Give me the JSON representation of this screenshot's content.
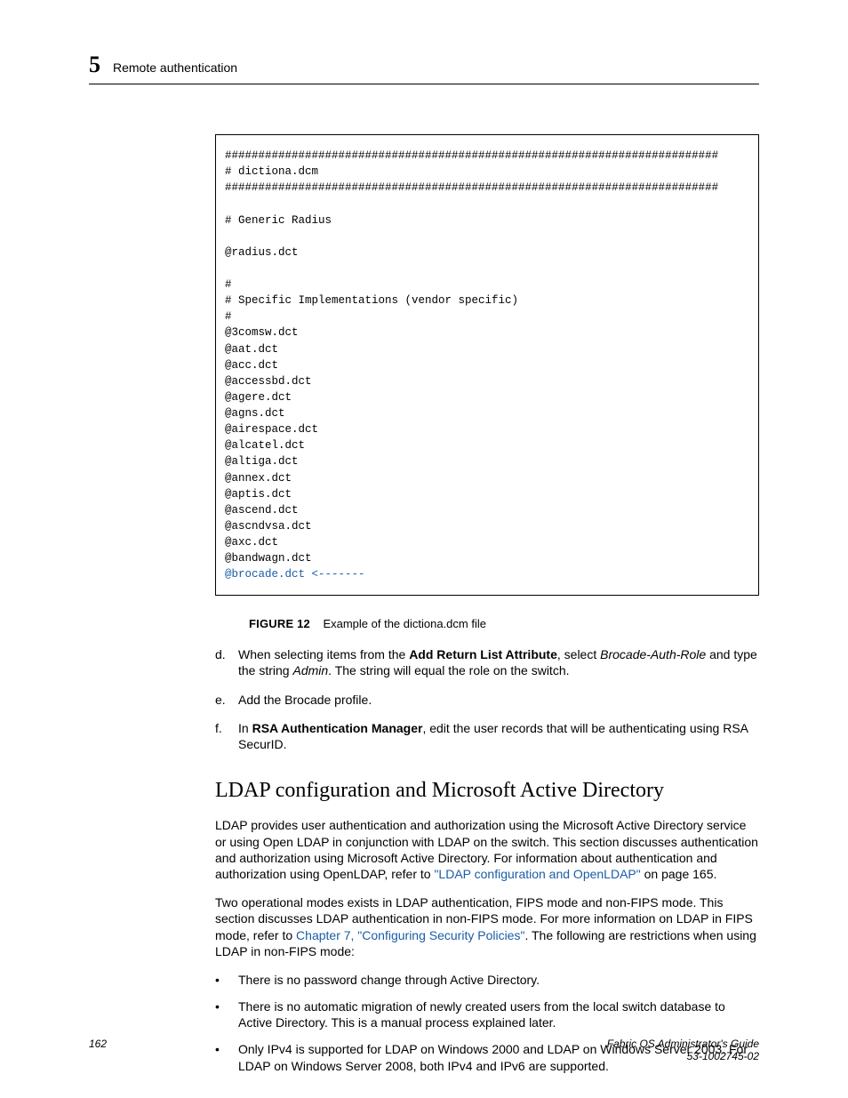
{
  "header": {
    "chapter_number": "5",
    "chapter_title": "Remote authentication"
  },
  "code_block": {
    "lines": [
      "##########################################################################",
      "# dictiona.dcm",
      "##########################################################################",
      "",
      "# Generic Radius",
      "",
      "@radius.dct",
      "",
      "#",
      "# Specific Implementations (vendor specific)",
      "#",
      "@3comsw.dct",
      "@aat.dct",
      "@acc.dct",
      "@accessbd.dct",
      "@agere.dct",
      "@agns.dct",
      "@airespace.dct",
      "@alcatel.dct",
      "@altiga.dct",
      "@annex.dct",
      "@aptis.dct",
      "@ascend.dct",
      "@ascndvsa.dct",
      "@axc.dct",
      "@bandwagn.dct"
    ],
    "highlight_line": "@brocade.dct <-------"
  },
  "figure": {
    "label": "FIGURE 12",
    "caption": "Example of the dictiona.dcm file"
  },
  "steps": {
    "d": {
      "marker": "d.",
      "pre": "When selecting items from the ",
      "bold1": "Add Return List Attribute",
      "mid1": ", select ",
      "ital1": "Brocade-Auth-Role",
      "mid2": " and type the string ",
      "ital2": "Admin",
      "post": ". The string will equal the role on the switch."
    },
    "e": {
      "marker": "e.",
      "text": "Add the Brocade profile."
    },
    "f": {
      "marker": "f.",
      "pre": "In ",
      "bold1": "RSA Authentication Manager",
      "post": ", edit the user records that will be authenticating using RSA SecurID."
    }
  },
  "section": {
    "heading": "LDAP configuration and Microsoft Active Directory",
    "para1": {
      "t1": "LDAP provides user authentication and authorization using the Microsoft Active Directory service or using Open LDAP in conjunction with LDAP on the switch. This section discusses authentication and authorization using Microsoft Active Directory. For information about authentication and authorization using OpenLDAP, refer to ",
      "link": "\"LDAP configuration and OpenLDAP\"",
      "t2": " on page 165."
    },
    "para2": {
      "t1": "Two operational modes exists in LDAP authentication, FIPS mode and non-FIPS mode. This section discusses LDAP authentication in non-FIPS mode. For more information on LDAP in FIPS mode, refer to ",
      "link": "Chapter 7, \"Configuring Security Policies\"",
      "t2": ". The following are restrictions when using LDAP in non-FIPS mode:"
    },
    "bullets": [
      "There is no password change through Active Directory.",
      "There is no automatic migration of newly created users from the local switch database to Active Directory. This is a manual process explained later.",
      "Only IPv4 is supported for LDAP on Windows 2000 and LDAP on Windows Server 2003. For LDAP on Windows Server 2008, both IPv4 and IPv6 are supported."
    ]
  },
  "footer": {
    "page": "162",
    "title": "Fabric OS Administrator's Guide",
    "docnum": "53-1002745-02"
  }
}
